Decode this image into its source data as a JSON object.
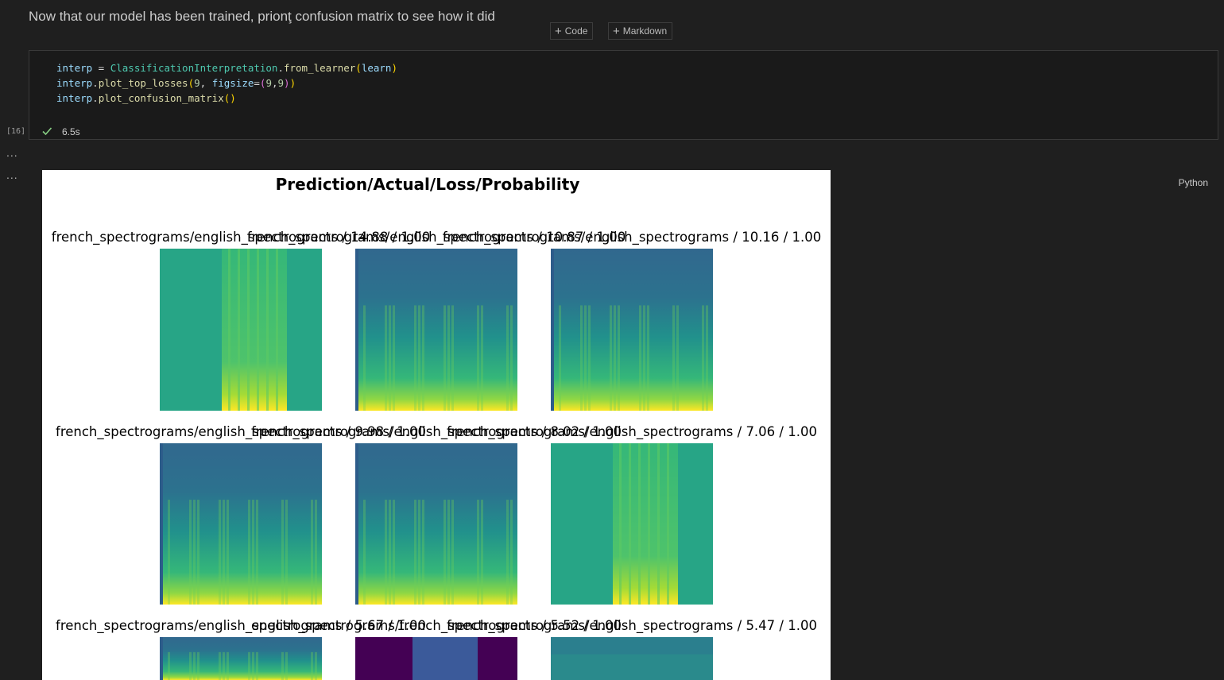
{
  "markdown": {
    "text": "Now that our model has been trained, prionţ confusion matrix to see how it did"
  },
  "toolbar": {
    "add_code": "Code",
    "add_markdown": "Markdown"
  },
  "cell": {
    "execution_count": "[16]",
    "status_time": "6.5s",
    "language": "Python",
    "code": {
      "line1": {
        "var": "interp",
        "eq": " = ",
        "cls": "ClassificationInterpretation",
        "dot": ".",
        "fn": "from_learner",
        "open": "(",
        "arg": "learn",
        "close": ")"
      },
      "line2": {
        "var": "interp",
        "dot": ".",
        "fn": "plot_top_losses",
        "open": "(",
        "n": "9",
        "comma": ", ",
        "kw": "figsize",
        "eq": "=",
        "p2open": "(",
        "a": "9",
        "c": ",",
        "b": "9",
        "p2close": ")",
        "close": ")"
      },
      "line3": {
        "var": "interp",
        "dot": ".",
        "fn": "plot_confusion_matrix",
        "open": "(",
        "close": ")"
      }
    }
  },
  "output": {
    "more_dots": [
      "...",
      "..."
    ],
    "figure_title": "Prediction/Actual/Loss/Probability",
    "panels": [
      {
        "title": "french_spectrograms/english_spectrograms / 14.88 / 1.00",
        "cmap": "flat-green"
      },
      {
        "title": "french_spectrograms/english_spectrograms / 10.87 / 1.00",
        "cmap": "blue-top"
      },
      {
        "title": "french_spectrograms/english_spectrograms / 10.16 / 1.00",
        "cmap": "blue-top"
      },
      {
        "title": "french_spectrograms/english_spectrograms / 9.98 / 1.00",
        "cmap": "blue-top"
      },
      {
        "title": "french_spectrograms/english_spectrograms / 8.02 / 1.00",
        "cmap": "blue-top"
      },
      {
        "title": "french_spectrograms/english_spectrograms / 7.06 / 1.00",
        "cmap": "flat-green"
      },
      {
        "title": "french_spectrograms/english_spectrograms / 5.67 / 1.00",
        "cmap": "blue-top"
      },
      {
        "title": "english_spectrograms/french_spectrograms / 5.52 / 1.00",
        "cmap": "purple"
      },
      {
        "title": "french_spectrograms/english_spectrograms / 5.47 / 1.00",
        "cmap": "teal"
      }
    ]
  },
  "colors": {
    "background": "#1f1f1f",
    "check": "#89d185",
    "viridis_purple": "#440154",
    "viridis_blue": "#31688e",
    "viridis_teal": "#21918c",
    "viridis_green": "#35b779",
    "viridis_yellow": "#fde725"
  }
}
